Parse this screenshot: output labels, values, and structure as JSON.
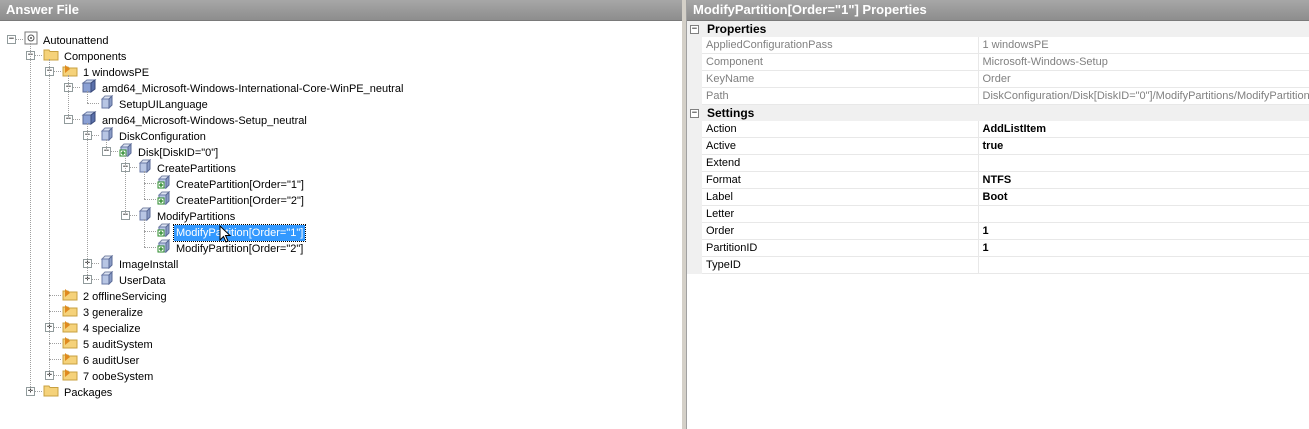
{
  "left_panel": {
    "title": "Answer File"
  },
  "right_panel": {
    "title": "ModifyPartition[Order=\"1\"] Properties"
  },
  "tree": [
    {
      "label": "Autounattend",
      "icon": "gear-icon",
      "expanded": true
    },
    {
      "label": "Components",
      "icon": "folder-icon",
      "expanded": true
    },
    {
      "label": "1 windowsPE",
      "icon": "pass-icon",
      "expanded": true
    },
    {
      "label": "amd64_Microsoft-Windows-International-Core-WinPE_neutral",
      "icon": "component-icon",
      "expanded": true
    },
    {
      "label": "SetupUILanguage",
      "icon": "setting-icon"
    },
    {
      "label": "amd64_Microsoft-Windows-Setup_neutral",
      "icon": "component-icon",
      "expanded": true
    },
    {
      "label": "DiskConfiguration",
      "icon": "setting-icon",
      "expanded": true
    },
    {
      "label": "Disk[DiskID=\"0\"]",
      "icon": "list-item-icon",
      "expanded": true
    },
    {
      "label": "CreatePartitions",
      "icon": "setting-icon",
      "expanded": true
    },
    {
      "label": "CreatePartition[Order=\"1\"]",
      "icon": "list-item-icon"
    },
    {
      "label": "CreatePartition[Order=\"2\"]",
      "icon": "list-item-icon"
    },
    {
      "label": "ModifyPartitions",
      "icon": "setting-icon",
      "expanded": true
    },
    {
      "label": "ModifyPartition[Order=\"1\"]",
      "icon": "list-item-icon",
      "selected": true
    },
    {
      "label": "ModifyPartition[Order=\"2\"]",
      "icon": "list-item-icon"
    },
    {
      "label": "ImageInstall",
      "icon": "setting-icon",
      "expanded": false
    },
    {
      "label": "UserData",
      "icon": "setting-icon",
      "expanded": false
    },
    {
      "label": "2 offlineServicing",
      "icon": "pass-icon"
    },
    {
      "label": "3 generalize",
      "icon": "pass-icon"
    },
    {
      "label": "4 specialize",
      "icon": "pass-icon",
      "expanded": false
    },
    {
      "label": "5 auditSystem",
      "icon": "pass-icon"
    },
    {
      "label": "6 auditUser",
      "icon": "pass-icon"
    },
    {
      "label": "7 oobeSystem",
      "icon": "pass-icon",
      "expanded": false
    },
    {
      "label": "Packages",
      "icon": "folder-icon",
      "expanded": false
    }
  ],
  "properties": {
    "cat_properties": "Properties",
    "cat_settings": "Settings",
    "readonly": [
      {
        "key": "AppliedConfigurationPass",
        "value": "1 windowsPE"
      },
      {
        "key": "Component",
        "value": "Microsoft-Windows-Setup"
      },
      {
        "key": "KeyName",
        "value": "Order"
      },
      {
        "key": "Path",
        "value": "DiskConfiguration/Disk[DiskID=\"0\"]/ModifyPartitions/ModifyPartition"
      }
    ],
    "settings": [
      {
        "key": "Action",
        "value": "AddListItem"
      },
      {
        "key": "Active",
        "value": "true"
      },
      {
        "key": "Extend",
        "value": ""
      },
      {
        "key": "Format",
        "value": "NTFS"
      },
      {
        "key": "Label",
        "value": "Boot"
      },
      {
        "key": "Letter",
        "value": ""
      },
      {
        "key": "Order",
        "value": "1"
      },
      {
        "key": "PartitionID",
        "value": "1"
      },
      {
        "key": "TypeID",
        "value": ""
      }
    ]
  },
  "colors": {
    "title_bg": "#999999",
    "selection": "#3399ff"
  }
}
